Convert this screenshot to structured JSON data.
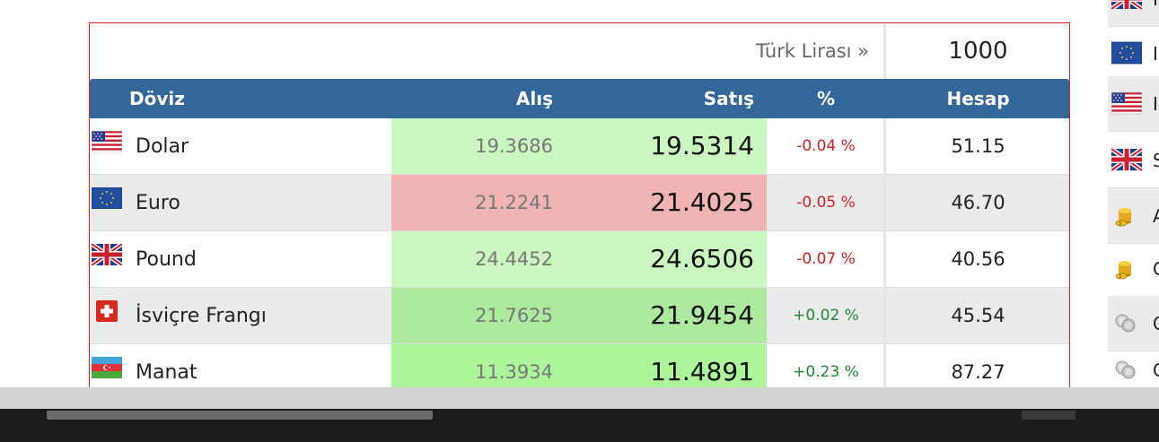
{
  "converter": {
    "currency_label": "Türk Lirası »",
    "amount": "1000"
  },
  "table": {
    "headers": {
      "doviz": "Döviz",
      "alis": "Alış",
      "satis": "Satış",
      "pct": "%",
      "hesap": "Hesap"
    },
    "rows": [
      {
        "flag": "us-flag-icon",
        "name": "Dolar",
        "alis": "19.3686",
        "satis": "19.5314",
        "pct": "-0.04 %",
        "trend": "down",
        "hesap": "51.15",
        "cell_color": "#c9f7bf"
      },
      {
        "flag": "eu-flag-icon",
        "name": "Euro",
        "alis": "21.2241",
        "satis": "21.4025",
        "pct": "-0.05 %",
        "trend": "down",
        "hesap": "46.70",
        "cell_color": "#f0b4b4"
      },
      {
        "flag": "uk-flag-icon",
        "name": "Pound",
        "alis": "24.4452",
        "satis": "24.6506",
        "pct": "-0.07 %",
        "trend": "down",
        "hesap": "40.56",
        "cell_color": "#c9f7bf"
      },
      {
        "flag": "ch-flag-icon",
        "name": "İsviçre Frangı",
        "alis": "21.7625",
        "satis": "21.9454",
        "pct": "+0.02 %",
        "trend": "up",
        "hesap": "45.54",
        "cell_color": "#aee9a0"
      },
      {
        "flag": "az-flag-icon",
        "name": "Manat",
        "alis": "11.3934",
        "satis": "11.4891",
        "pct": "+0.23 %",
        "trend": "up",
        "hesap": "87.27",
        "cell_color": "#adf59b"
      }
    ]
  },
  "sidebar": {
    "items": [
      {
        "icon": "uk-flag-icon",
        "letter": "I"
      },
      {
        "icon": "eu-flag-icon",
        "letter": "I"
      },
      {
        "icon": "us-flag-icon",
        "letter": "I"
      },
      {
        "icon": "uk-flag-icon",
        "letter": "S"
      },
      {
        "icon": "gold-coins-icon",
        "letter": "A"
      },
      {
        "icon": "gold-coins-icon",
        "letter": "C"
      },
      {
        "icon": "silver-coins-icon",
        "letter": "C"
      },
      {
        "icon": "silver-coins-icon",
        "letter": "C"
      }
    ]
  },
  "colors": {
    "header_bg": "#336699",
    "border_red": "#d9231f",
    "down": "#cc2222",
    "up": "#228833"
  }
}
